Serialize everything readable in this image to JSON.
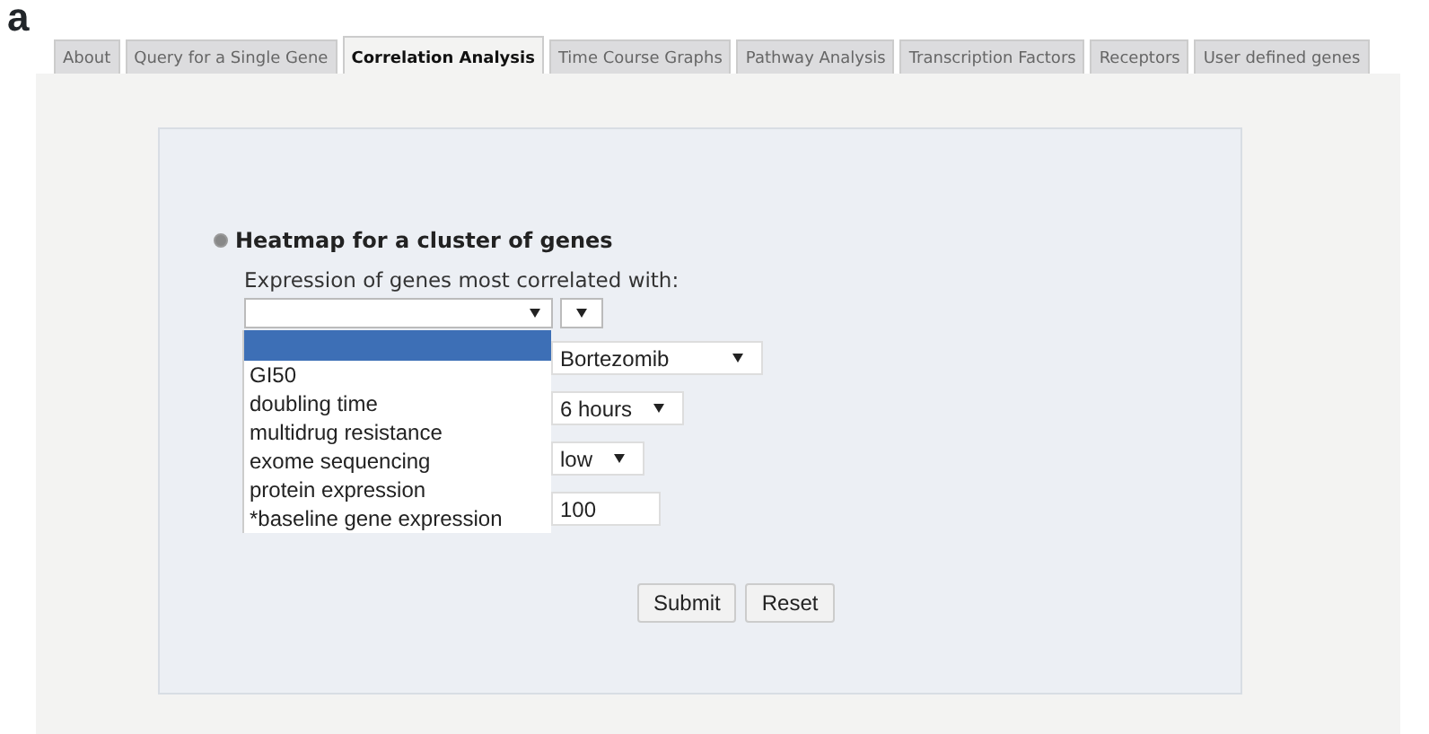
{
  "figure_label": "a",
  "tabs": [
    {
      "label": "About",
      "selected": false
    },
    {
      "label": "Query for a Single Gene",
      "selected": false
    },
    {
      "label": "Correlation Analysis",
      "selected": true
    },
    {
      "label": "Time Course Graphs",
      "selected": false
    },
    {
      "label": "Pathway Analysis",
      "selected": false
    },
    {
      "label": "Transcription Factors",
      "selected": false
    },
    {
      "label": "Receptors",
      "selected": false
    },
    {
      "label": "User defined genes",
      "selected": false
    }
  ],
  "option": {
    "label": "Heatmap for a cluster of genes",
    "selected": true
  },
  "correlated_with": {
    "label": "Expression of genes most correlated with:",
    "dropdown_options": [
      {
        "selected": true
      },
      {
        "label": "GI50",
        "selected": false
      },
      {
        "label": "doubling time",
        "selected": false
      },
      {
        "label": "multidrug resistance",
        "selected": false
      },
      {
        "label": "exome sequencing",
        "selected": false
      },
      {
        "label": "protein expression",
        "selected": false
      },
      {
        "label": "*baseline gene expression",
        "selected": false
      }
    ]
  },
  "fields": [
    {
      "kind": "select",
      "value": "Bortezomib"
    },
    {
      "kind": "select",
      "value": "6 hours"
    },
    {
      "kind": "select",
      "value": "low"
    },
    {
      "kind": "input",
      "value": "100"
    }
  ],
  "buttons": [
    "Submit",
    "Reset"
  ]
}
